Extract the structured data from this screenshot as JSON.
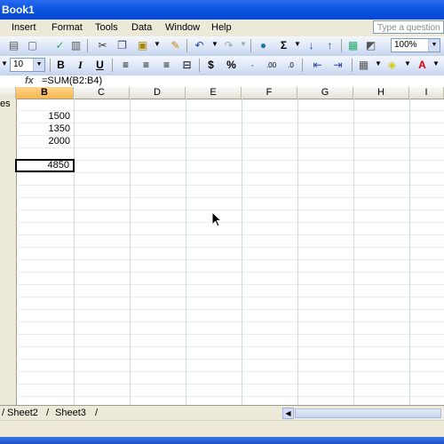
{
  "window": {
    "title": "Book1"
  },
  "menu": {
    "items": [
      {
        "label": "Insert"
      },
      {
        "label": "Format"
      },
      {
        "label": "Tools"
      },
      {
        "label": "Data"
      },
      {
        "label": "Window"
      },
      {
        "label": "Help"
      }
    ],
    "help_placeholder": "Type a question"
  },
  "toolbar": {
    "zoom": "100%",
    "font_size": "10",
    "bold": "B",
    "italic": "I",
    "underline": "U",
    "currency": "$",
    "percent": "%",
    "sigma": "Σ"
  },
  "formula_bar": {
    "fx_label": "fx",
    "formula": "=SUM(B2:B4)"
  },
  "columns": [
    "B",
    "C",
    "D",
    "E",
    "F",
    "G",
    "H",
    "I"
  ],
  "selected_column": "B",
  "cells": {
    "a1_partial": "es",
    "b2": "1500",
    "b3": "1350",
    "b4": "2000",
    "b6": "4850"
  },
  "sheet_tabs": [
    "Sheet2",
    "Sheet3"
  ],
  "icons": [
    "open-icon",
    "save-icon",
    "print-icon",
    "spellcheck-icon",
    "cut-icon",
    "copy-icon",
    "paste-icon",
    "format-painter-icon",
    "undo-icon",
    "redo-icon",
    "hyperlink-icon",
    "autosum-icon",
    "sort-ascending-icon",
    "sort-descending-icon",
    "borders-icon",
    "fill-color-icon",
    "font-color-icon",
    "mouse-cursor-icon"
  ],
  "colors": {
    "title_bar": "#0b54e0",
    "selected_column_header": "#f8b64d",
    "gridline": "#d0d7e5"
  }
}
